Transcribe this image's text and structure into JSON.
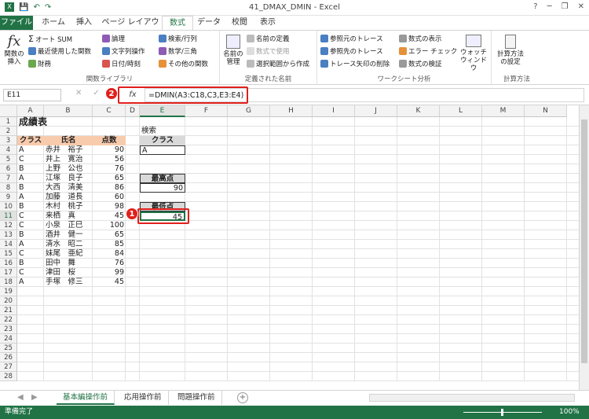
{
  "window": {
    "title": "41_DMAX_DMIN - Excel",
    "minimize": "─",
    "restore": "❐",
    "close": "✕",
    "help": "?"
  },
  "ribbon_tabs": [
    "ファイル",
    "ホーム",
    "挿入",
    "ページ レイアウト",
    "数式",
    "データ",
    "校閲",
    "表示"
  ],
  "ribbon": {
    "insert_function": "関数の挿入",
    "fx_symbol": "fx",
    "g1": [
      "オート SUM",
      "最近使用した関数",
      "財務"
    ],
    "g2": [
      "論理",
      "文字列操作",
      "日付/時刻"
    ],
    "g3": [
      "検索/行列",
      "数学/三角",
      "その他の関数"
    ],
    "group1_label": "関数ライブラリ",
    "name_manager": "名前の管理",
    "names": [
      "名前の定義",
      "数式で使用",
      "選択範囲から作成"
    ],
    "group2_label": "定義された名前",
    "audit1": [
      "参照元のトレース",
      "参照先のトレース",
      "トレース矢印の削除"
    ],
    "audit2": [
      "数式の表示",
      "エラー チェック",
      "数式の検証"
    ],
    "watch": "ウォッチウィンドウ",
    "group3_label": "ワークシート分析",
    "calc_options": "計算方法の設定",
    "group4_label": "計算方法"
  },
  "formula_bar": {
    "name_box": "E11",
    "cancel": "✕",
    "enter": "✓",
    "fx": "fx",
    "formula": "=DMIN(A3:C18,C3,E3:E4)"
  },
  "columns": [
    "A",
    "B",
    "C",
    "D",
    "E",
    "F",
    "G",
    "H",
    "I",
    "J",
    "K",
    "L",
    "M",
    "N"
  ],
  "rows": [
    "1",
    "2",
    "3",
    "4",
    "5",
    "6",
    "7",
    "8",
    "9",
    "10",
    "11",
    "12",
    "13",
    "14",
    "15",
    "16",
    "17",
    "18",
    "19",
    "20",
    "21",
    "22",
    "23",
    "24",
    "25",
    "26",
    "27",
    "28"
  ],
  "sheet": {
    "title": "成績表",
    "headers": [
      "クラス",
      "氏名",
      "点数"
    ],
    "records": [
      [
        "A",
        "赤井　裕子",
        "90"
      ],
      [
        "C",
        "井上　寛治",
        "56"
      ],
      [
        "B",
        "上野　公也",
        "76"
      ],
      [
        "A",
        "江塚　良子",
        "65"
      ],
      [
        "B",
        "大西　清美",
        "86"
      ],
      [
        "A",
        "加藤　道長",
        "60"
      ],
      [
        "B",
        "木村　桃子",
        "98"
      ],
      [
        "C",
        "来栖　真",
        "45"
      ],
      [
        "C",
        "小泉　正巳",
        "100"
      ],
      [
        "B",
        "酒井　健一",
        "65"
      ],
      [
        "A",
        "清水　昭二",
        "85"
      ],
      [
        "C",
        "妹尾　亜紀",
        "84"
      ],
      [
        "B",
        "田中　舞",
        "76"
      ],
      [
        "C",
        "津田　桜",
        "99"
      ],
      [
        "A",
        "手塚　修三",
        "45"
      ]
    ],
    "search_label": "検索",
    "criteria_header": "クラス",
    "criteria_value": "A",
    "max_label": "最高点",
    "max_value": "90",
    "min_label": "最低点",
    "min_value": "45"
  },
  "badges": {
    "one": "1",
    "two": "2"
  },
  "sheet_tabs": [
    "基本編操作前",
    "応用操作前",
    "問題操作前"
  ],
  "add_sheet": "+",
  "status": {
    "ready": "準備完了",
    "zoom": "100%"
  },
  "colors": {
    "accent": "#217346",
    "header_fill": "#f8cbad",
    "label_fill": "#d9d9d9",
    "highlight": "#e0201c"
  }
}
